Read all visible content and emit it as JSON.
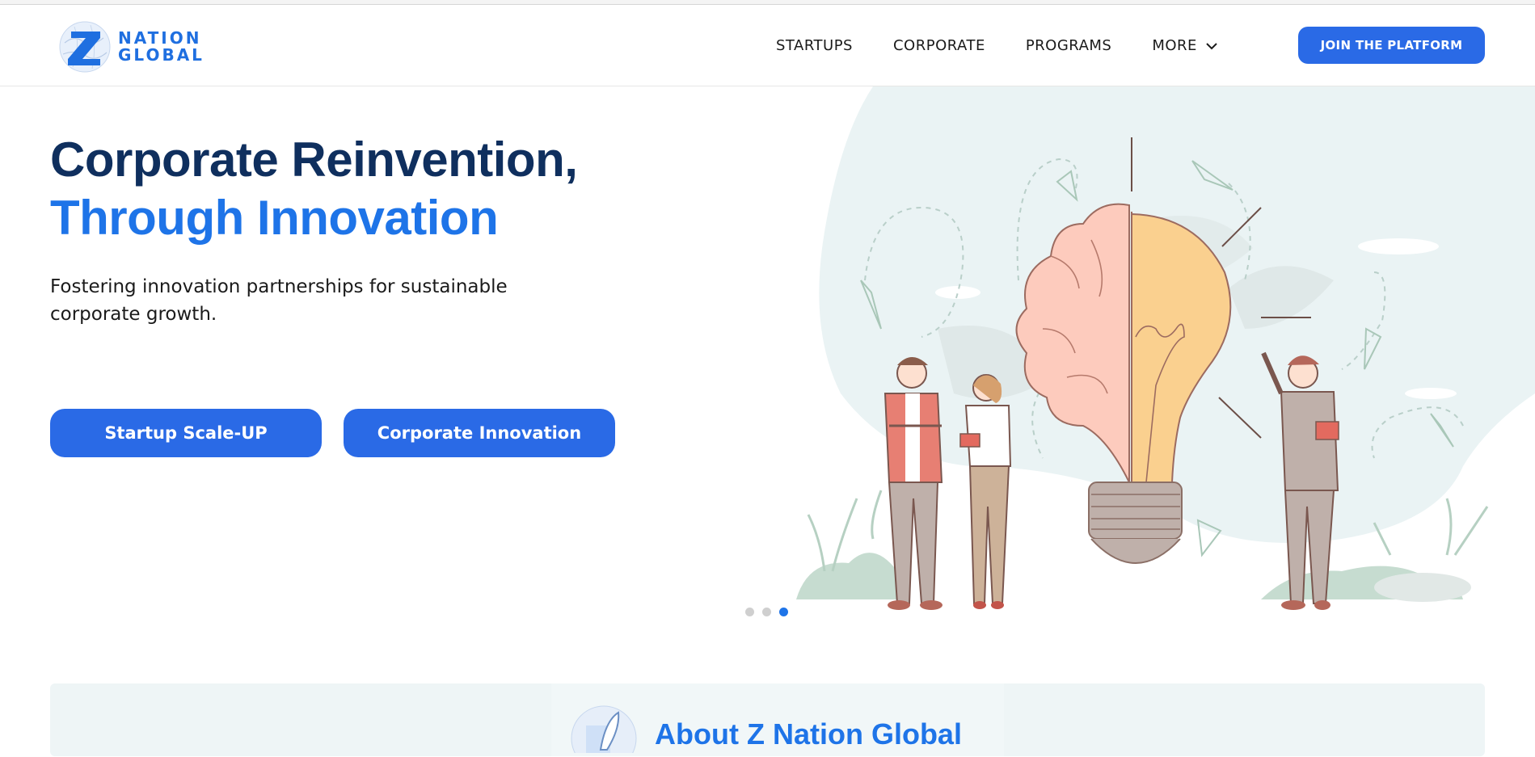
{
  "brand": {
    "line1": "NATION",
    "line2": "GLOBAL",
    "logo_icon": "z-globe-logo-icon",
    "accent": "#1e74e8",
    "button_color": "#2a6ae6",
    "title_dark": "#0f2f5e"
  },
  "nav": {
    "items": [
      {
        "label": "STARTUPS"
      },
      {
        "label": "CORPORATE"
      },
      {
        "label": "PROGRAMS"
      },
      {
        "label": "MORE"
      }
    ],
    "more_icon": "chevron-down-icon",
    "join_label": "JOIN THE PLATFORM"
  },
  "hero": {
    "title_line1": "Corporate Reinvention,",
    "title_line2": "Through Innovation",
    "subtitle": "Fostering innovation partnerships for sustainable corporate growth.",
    "cta_primary": "Startup Scale-UP",
    "cta_secondary": "Corporate Innovation",
    "carousel": {
      "slides": 3,
      "active_index": 3
    }
  },
  "about": {
    "title": "About Z Nation Global"
  }
}
